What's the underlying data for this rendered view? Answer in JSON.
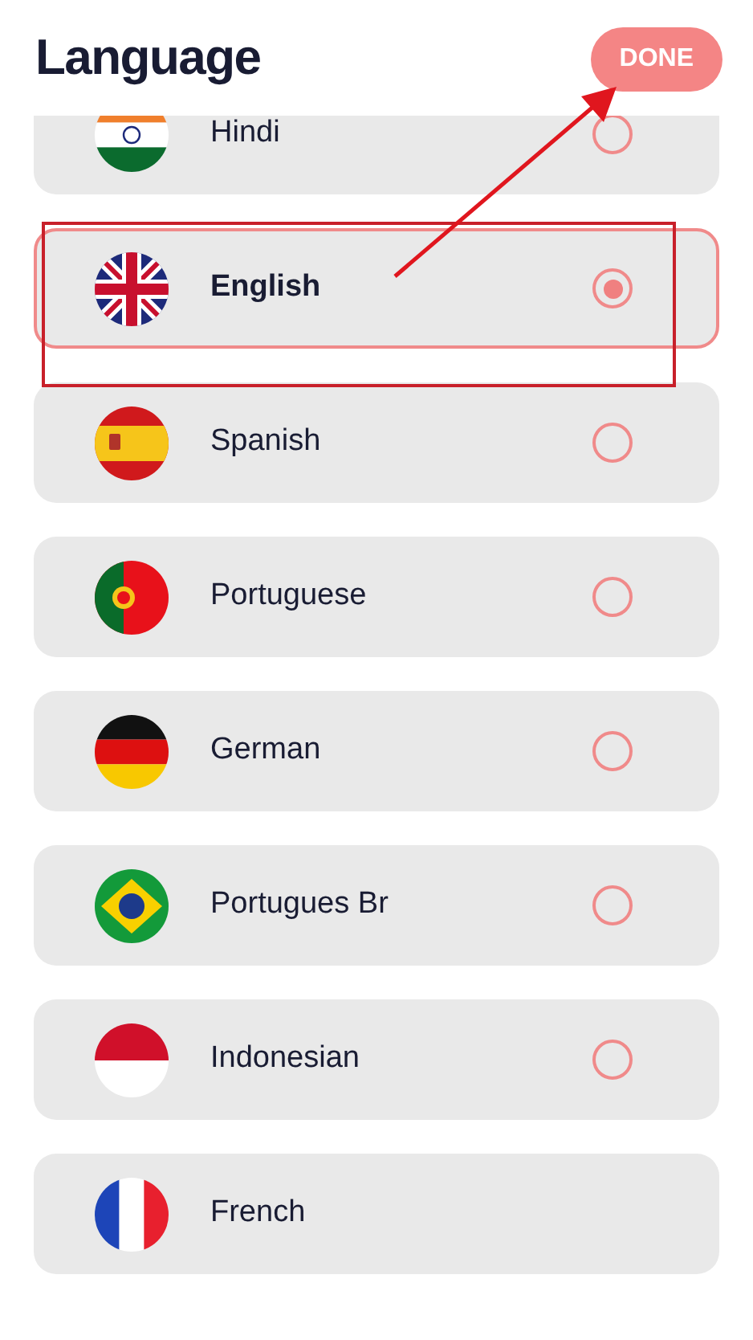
{
  "header": {
    "title": "Language",
    "done_button": "DONE"
  },
  "languages": [
    {
      "name": "Hindi",
      "selected": false,
      "kind": "radio"
    },
    {
      "name": "English",
      "selected": true,
      "kind": "radio"
    },
    {
      "name": "Spanish",
      "selected": false,
      "kind": "radio"
    },
    {
      "name": "Portuguese",
      "selected": false,
      "kind": "radio"
    },
    {
      "name": "German",
      "selected": false,
      "kind": "radio"
    },
    {
      "name": "Portugues Br",
      "selected": false,
      "kind": "radio"
    },
    {
      "name": "Indonesian",
      "selected": false,
      "kind": "radio"
    },
    {
      "name": "French",
      "selected": false,
      "kind": "plain"
    }
  ]
}
